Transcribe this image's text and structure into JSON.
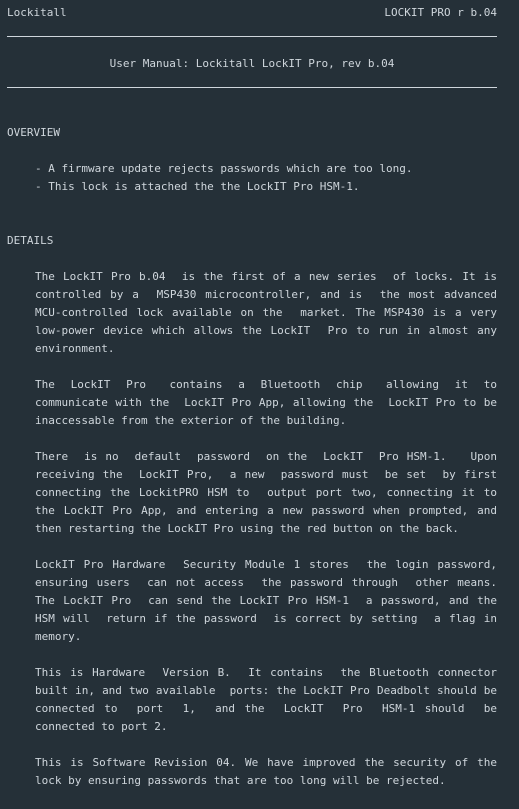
{
  "header": {
    "app_name": "Lockitall",
    "version_label": "LOCKIT PRO r b.04"
  },
  "manual_title": "User Manual: Lockitall LockIT Pro, rev b.04",
  "overview": {
    "heading": "OVERVIEW",
    "bullets": [
      "- A firmware update rejects passwords which are too long.",
      "- This lock is attached the the LockIT Pro HSM-1."
    ]
  },
  "details": {
    "heading": "DETAILS",
    "paragraphs": [
      "The LockIT Pro b.04  is the first of a new series  of locks. It is controlled by a  MSP430 microcontroller, and is  the most advanced MCU-controlled lock available on the  market. The MSP430 is a very low-power device which allows the LockIT  Pro to run in almost any environment.",
      "The  LockIT  Pro   contains  a  Bluetooth  chip   allowing  it  to communicate with the  LockIT Pro App, allowing the  LockIT Pro to be inaccessable from the exterior of the building.",
      "There  is no  default  password  on the  LockIT  Pro HSM-1.   Upon receiving the  LockIT Pro,  a new  password must  be set  by first connecting the LockitPRO HSM to  output port two, connecting it to the LockIT Pro App, and entering a new password when prompted, and then restarting the LockIT Pro using the red button on the back.",
      "LockIT Pro Hardware  Security Module 1 stores  the login password, ensuring users  can not access  the password through  other means. The LockIT Pro  can send the LockIT Pro HSM-1  a password, and the HSM will  return if the password  is correct by setting  a flag in memory.",
      "This is Hardware  Version B.  It contains  the Bluetooth connector built in, and two available  ports: the LockIT Pro Deadbolt should be  connected to  port  1,  and the  LockIT  Pro  HSM-1 should  be connected to port 2.",
      "This is Software Revision 04. We have improved the security of the lock by ensuring passwords that are too long will be rejected."
    ]
  }
}
